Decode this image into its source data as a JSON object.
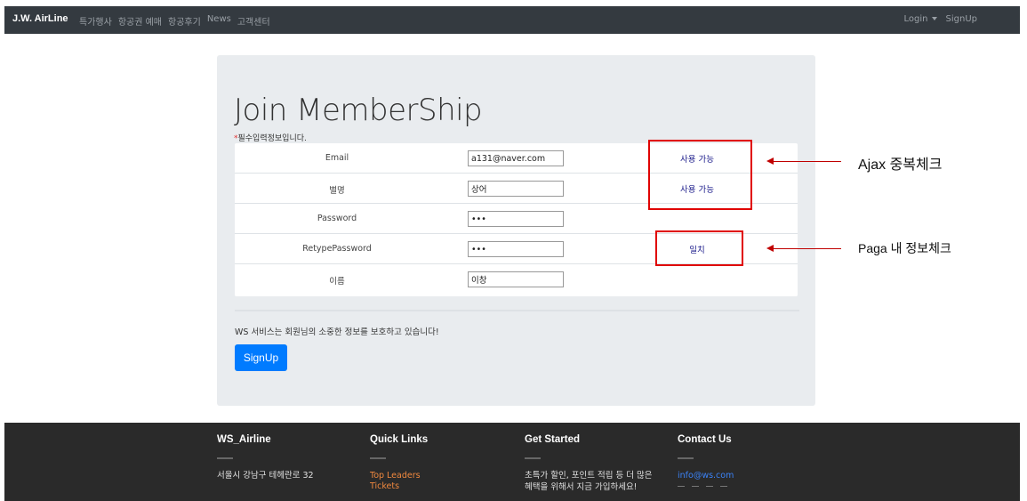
{
  "navbar": {
    "brand": "J.W. AirLine",
    "links": [
      "특가행사",
      "항공권 예매",
      "항공후기",
      "News",
      "고객센터"
    ],
    "login": "Login",
    "signup": "SignUp"
  },
  "form": {
    "title": "Join MemberShip",
    "required_star": "*",
    "required_note": "필수입력정보입니다.",
    "rows": [
      {
        "label": "Email",
        "value": "a131@naver.com",
        "status": "사용 가능"
      },
      {
        "label": "별명",
        "value": "상어",
        "status": "사용 가능"
      },
      {
        "label": "Password",
        "value": "•••",
        "status": ""
      },
      {
        "label": "RetypePassword",
        "value": "•••",
        "status": "일치"
      },
      {
        "label": "이름",
        "value": "이창",
        "status": ""
      }
    ],
    "service_note": "WS 서비스는 회원님의 소중한 정보를 보호하고 있습니다!",
    "submit_label": "SignUp"
  },
  "annotations": {
    "ajax": "Ajax 중복체크",
    "page": "Paga 내 정보체크",
    "color": "#e00000"
  },
  "footer": {
    "col1": {
      "title": "WS_Airline",
      "text": "서울시 강남구 테헤란로 32"
    },
    "col2": {
      "title": "Quick Links",
      "links": [
        "Top Leaders",
        "Tickets"
      ]
    },
    "col3": {
      "title": "Get Started",
      "text1": "초특가 할인, 포인트 적립 등 더 많은",
      "text2": "혜택을 위해서 지금 가입하세요!"
    },
    "col4": {
      "title": "Contact Us",
      "email": "info@ws.com"
    }
  },
  "colors": {
    "navbar": "#343a40",
    "card": "#e9ecef",
    "primary": "#007bff",
    "footer": "#2a2a2a",
    "footer_link": "#f0883e"
  }
}
